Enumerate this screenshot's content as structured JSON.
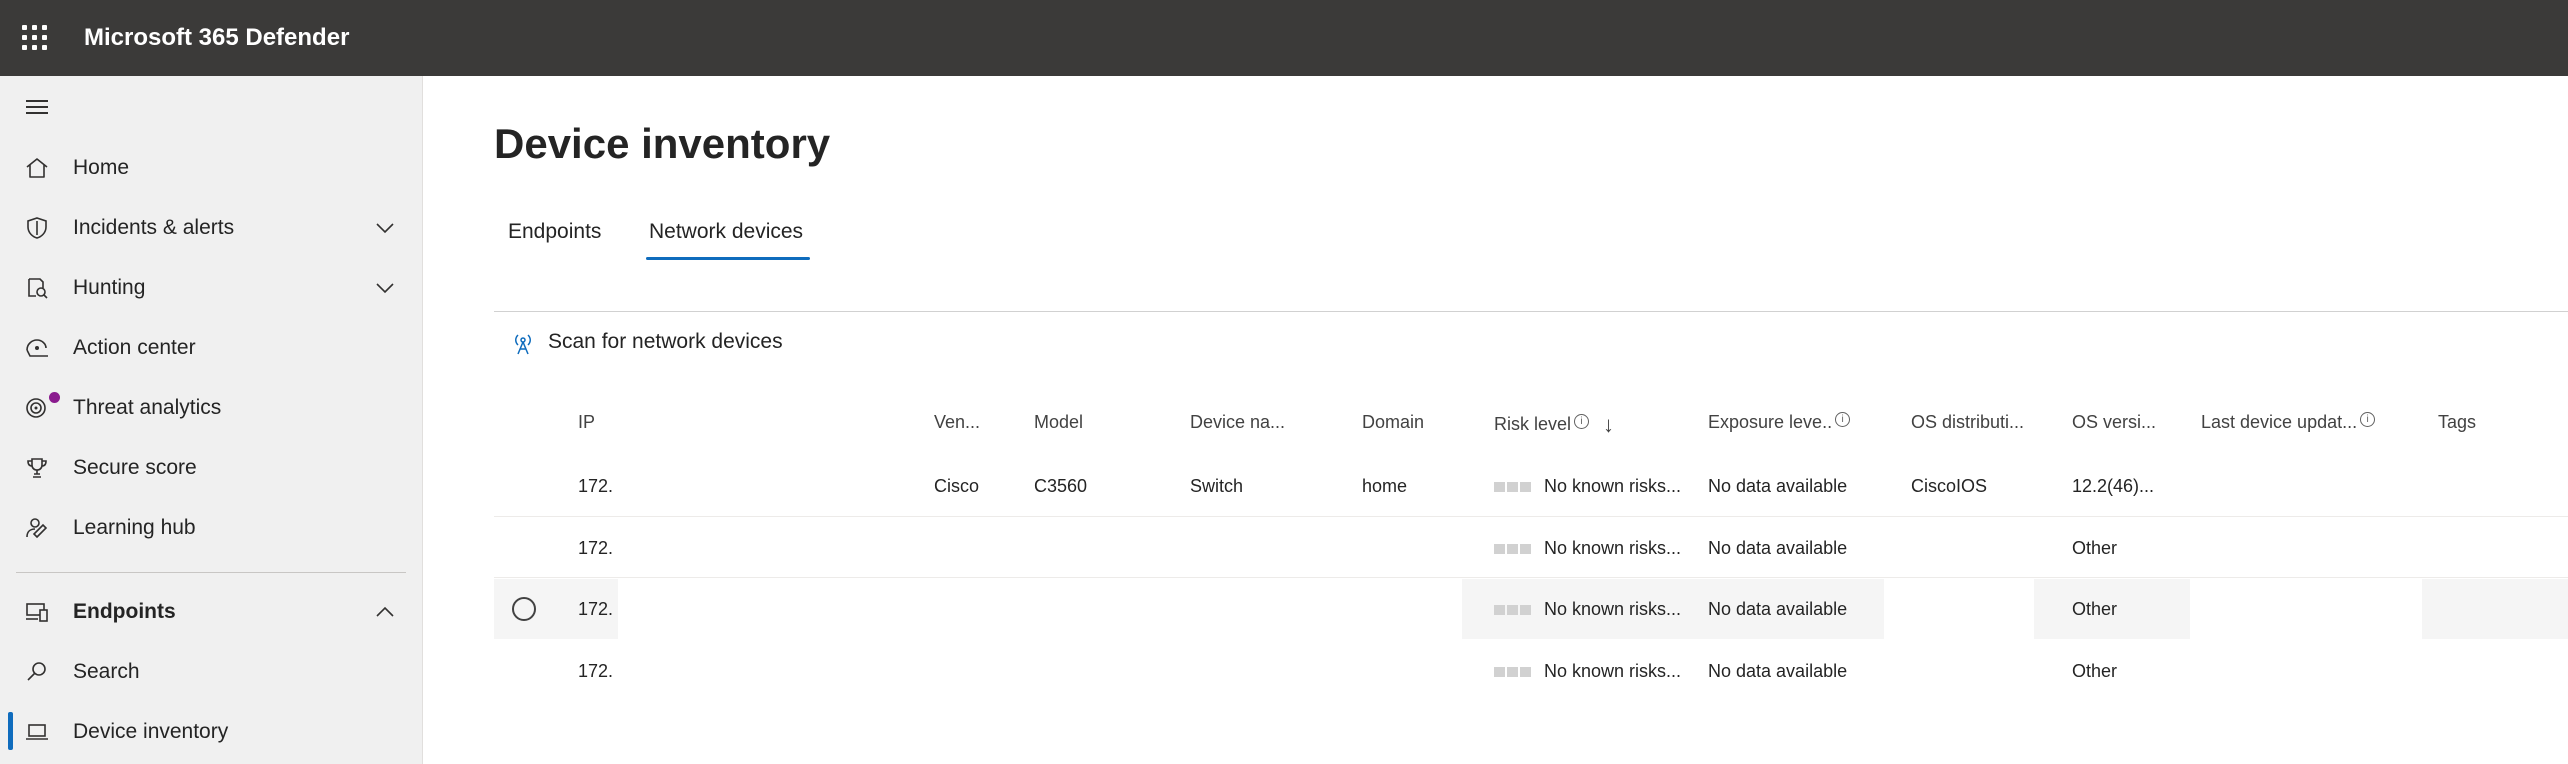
{
  "app": {
    "title": "Microsoft 365 Defender"
  },
  "sidebar": {
    "items": [
      {
        "label": "Home",
        "icon": "home-icon"
      },
      {
        "label": "Incidents & alerts",
        "icon": "shield-icon",
        "expandable": true
      },
      {
        "label": "Hunting",
        "icon": "hunting-icon",
        "expandable": true
      },
      {
        "label": "Action center",
        "icon": "action-center-icon"
      },
      {
        "label": "Threat analytics",
        "icon": "threat-analytics-icon"
      },
      {
        "label": "Secure score",
        "icon": "trophy-icon"
      },
      {
        "label": "Learning hub",
        "icon": "learning-hub-icon"
      },
      {
        "label": "Endpoints",
        "icon": "endpoints-icon",
        "expanded": true
      },
      {
        "label": "Search",
        "icon": "search-icon"
      },
      {
        "label": "Device inventory",
        "icon": "laptop-icon",
        "active": true
      }
    ]
  },
  "page": {
    "title": "Device inventory",
    "tabs": [
      "Endpoints",
      "Network devices"
    ],
    "selected_tab": "Network devices",
    "scan_button": "Scan for network devices"
  },
  "table": {
    "headers": {
      "ip": "IP",
      "vendor": "Ven...",
      "model": "Model",
      "device_name": "Device na...",
      "domain": "Domain",
      "risk_level": "Risk level",
      "exposure_level": "Exposure leve..",
      "os_distribution": "OS distributi...",
      "os_version": "OS versi...",
      "last_update": "Last device updat...",
      "tags": "Tags"
    },
    "rows": [
      {
        "ip": "172.",
        "vendor": "Cisco",
        "model": "C3560",
        "device_name": "Switch",
        "domain": "home",
        "risk": "No known risks...",
        "exposure": "No data available",
        "os_distribution": "CiscoIOS",
        "os_version": "12.2(46)..."
      },
      {
        "ip": "172.",
        "vendor": "",
        "model": "",
        "device_name": "",
        "domain": "",
        "risk": "No known risks...",
        "exposure": "No data available",
        "os_distribution": "",
        "os_version": "Other"
      },
      {
        "ip": "172.",
        "vendor": "",
        "model": "",
        "device_name": "",
        "domain": "",
        "risk": "No known risks...",
        "exposure": "No data available",
        "os_distribution": "",
        "os_version": "Other"
      },
      {
        "ip": "172.",
        "vendor": "",
        "model": "",
        "device_name": "",
        "domain": "",
        "risk": "No known risks...",
        "exposure": "No data available",
        "os_distribution": "",
        "os_version": "Other"
      }
    ]
  },
  "colors": {
    "topbar": "#3b3a39",
    "accent": "#0f6cbd",
    "sidebar_bg": "#f0f0f0",
    "notification_dot": "#8a1b8e"
  }
}
